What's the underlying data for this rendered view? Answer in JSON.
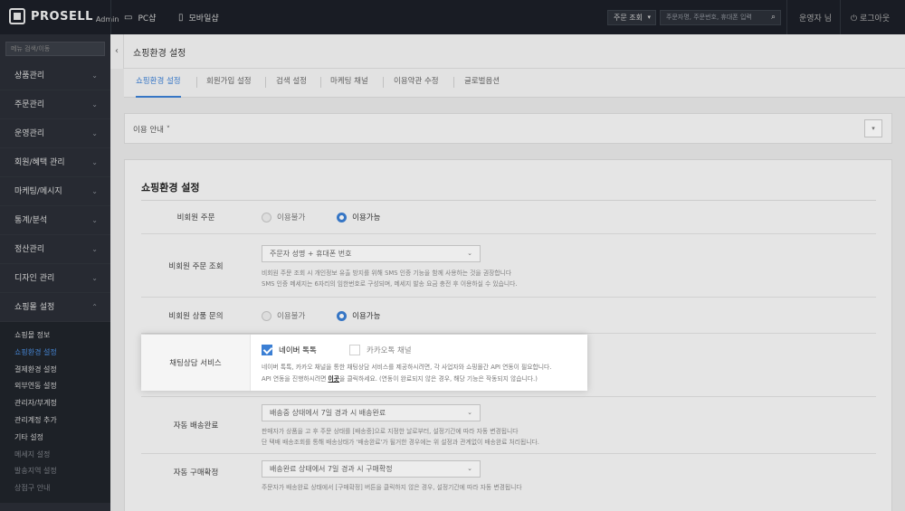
{
  "header": {
    "brand": "PROSELL",
    "brand_sub": "Admin",
    "nav_pc": "PC샵",
    "nav_mobile": "모바일샵",
    "order_select": "주문 조회",
    "search_placeholder": "주문자명, 주문번호, 휴대폰 입력",
    "operator": "운영자 님",
    "logout": "로그아웃"
  },
  "sidebar": {
    "search_placeholder": "메뉴 검색/이동",
    "items": [
      {
        "label": "상품관리"
      },
      {
        "label": "주문관리"
      },
      {
        "label": "운영관리"
      },
      {
        "label": "회원/혜택 관리"
      },
      {
        "label": "마케팅/메시지"
      },
      {
        "label": "통계/분석"
      },
      {
        "label": "정산관리"
      },
      {
        "label": "디자인 관리"
      },
      {
        "label": "쇼핑몰 설정"
      }
    ],
    "sub_items": [
      {
        "label": "쇼핑몰 정보"
      },
      {
        "label": "쇼핑환경 설정"
      },
      {
        "label": "결제환경 설정"
      },
      {
        "label": "외부연동 설정"
      },
      {
        "label": "관리자/부계정"
      },
      {
        "label": "관리계정 추가"
      },
      {
        "label": "기타 설정"
      },
      {
        "label": "메세지 설정"
      },
      {
        "label": "발송지역 설정"
      },
      {
        "label": "상점구 안내"
      }
    ]
  },
  "page": {
    "title": "쇼핑환경 설정",
    "tabs": [
      {
        "label": "쇼핑환경 설정"
      },
      {
        "label": "회원가입 설정"
      },
      {
        "label": "검색 설정"
      },
      {
        "label": "마케팅 채널"
      },
      {
        "label": "이용약관 수정"
      },
      {
        "label": "글로벌옵션"
      }
    ],
    "info_label": "이용 안내",
    "settings_title": "쇼핑환경 설정"
  },
  "form": {
    "guest_order": {
      "label": "비회원 주문",
      "option_off": "이용불가",
      "option_on": "이용가능"
    },
    "guest_lookup": {
      "label": "비회원 주문 조회",
      "select": "주문자 성명 + 휴대폰 번호",
      "desc1": "비회원 주문 조회 시 개인정보 유출 방지를 위해 SMS 인증 기능을 함께 사용하는 것을 권장합니다",
      "desc2": "SMS 인증 메세지는 6자리의 임한번호로 구성되며, 메세지 발송 요금 충전 후 이용하실 수 있습니다."
    },
    "guest_inquiry": {
      "label": "비회원 상품 문의",
      "option_off": "이용불가",
      "option_on": "이용가능"
    },
    "chat": {
      "label": "채팅상담 서비스",
      "naver": "네이버 톡톡",
      "kakao": "카카오톡 채널",
      "desc1": "네이버 톡톡, 카카오 채널을 통한 채팅상담 서비스를 제공하시려면, 각 사업자와 쇼핑몰간 API 연동이 필요합니다.",
      "desc2_pre": "API 연동을 진행하시려면 ",
      "desc2_link": "이곳",
      "desc2_post": "을 클릭하세요. (연동이 완료되지 않은 경우, 해당 기능은 작동되지 않습니다.)"
    },
    "auto_ship": {
      "label": "자동 배송완료",
      "select": "배송중 상태에서 7일 경과 시 배송완료",
      "desc1": "판매자가 상품을 고 후 주문 상태를 [배송중]으로 지정한 날로부터, 설정기간에 따라 자동 변경됩니다",
      "desc2": "단 택배 배송조회를 통해 배송상태가 '배송완료'가 될거한 경우에는 위 설정과 관계없이 배송완료 처리됩니다."
    },
    "auto_confirm": {
      "label": "자동 구매확정",
      "select": "배송완료 상태에서 7일 경과 시 구매확정",
      "desc1": "주문자가 배송완료 상태에서 [구매확정] 버튼을 클릭하지 않은 경우, 설정기간에 따라 자동 변경됩니다"
    }
  }
}
